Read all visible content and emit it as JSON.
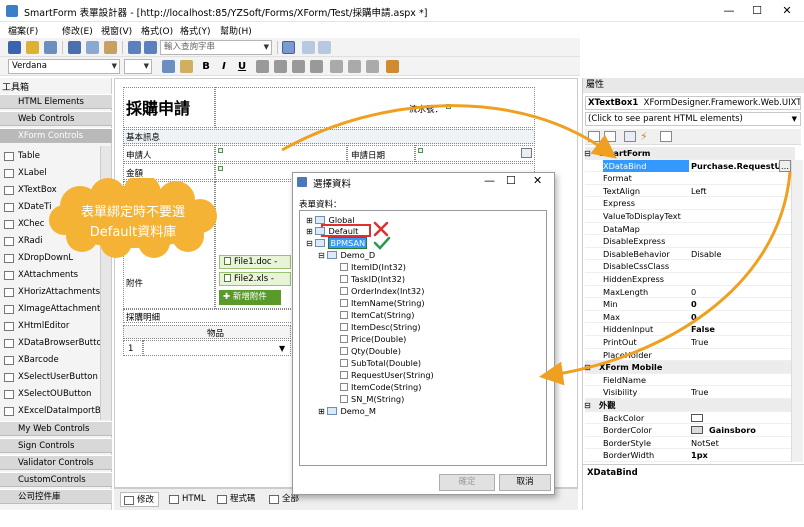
{
  "window": {
    "title": "SmartForm 表單設計器 - [http://localhost:85/YZSoft/Forms/XForm/Test/採購申請.aspx *]"
  },
  "menu": [
    "檔案(F)",
    "修改(E)",
    "視窗(V)",
    "格式(O)",
    "格式(Y)",
    "幫助(H)"
  ],
  "toolbar": {
    "input_placeholder": "輸入查詢字串",
    "font": "Verdana"
  },
  "toolbox": {
    "title": "工具箱",
    "groups_top": [
      "HTML Elements",
      "Web Controls",
      "XForm Controls"
    ],
    "items": [
      "Table",
      "XLabel",
      "XTextBox",
      "XDateTi",
      "XChec",
      "XRadi",
      "XDropDownL",
      "XAttachments",
      "XHorizAttachments",
      "XImageAttachment",
      "XHtmlEditor",
      "XDataBrowserButton",
      "XBarcode",
      "XSelectUserButton",
      "XSelectOUButton",
      "XExcelDataImportB..."
    ],
    "groups_bottom": [
      "My Web Controls",
      "Sign Controls",
      "Validator Controls",
      "CustomControls",
      "公司控件庫"
    ]
  },
  "form": {
    "title": "採購申請",
    "serial_label": "流水號：",
    "section_basic": "基本訊息",
    "applicant": "申請人",
    "apply_date": "申請日期",
    "amount": "金額",
    "attachments": "附件",
    "file1": "File1.doc -",
    "file2": "File2.xls -",
    "add_attachment": "新增附件",
    "section_detail": "採購明細",
    "item_col": "物品",
    "row_num": "1"
  },
  "bottom_tabs": [
    "修改",
    "HTML",
    "程式碼",
    "全部"
  ],
  "properties": {
    "title": "屬性",
    "object": "XTextBox1",
    "object_type": "XFormDesigner.Framework.Web.UIXTe",
    "parent_hint": "(Click to see parent HTML elements)",
    "rows": [
      {
        "name": "SmartForm",
        "value": "",
        "cat": true
      },
      {
        "name": "XDataBind",
        "value": "Purchase.RequestUse",
        "sel": true
      },
      {
        "name": "Format",
        "value": ""
      },
      {
        "name": "TextAlign",
        "value": "Left"
      },
      {
        "name": "Express",
        "value": ""
      },
      {
        "name": "ValueToDisplayText",
        "value": ""
      },
      {
        "name": "DataMap",
        "value": ""
      },
      {
        "name": "DisableExpress",
        "value": ""
      },
      {
        "name": "DisableBehavior",
        "value": "Disable"
      },
      {
        "name": "DisableCssClass",
        "value": ""
      },
      {
        "name": "HiddenExpress",
        "value": ""
      },
      {
        "name": "MaxLength",
        "value": "0"
      },
      {
        "name": "Min",
        "value": "0"
      },
      {
        "name": "Max",
        "value": "0"
      },
      {
        "name": "HiddenInput",
        "value": "False"
      },
      {
        "name": "PrintOut",
        "value": "True"
      },
      {
        "name": "PlaceHolder",
        "value": ""
      },
      {
        "name": "XForm Mobile",
        "value": "",
        "cat": true
      },
      {
        "name": "FieldName",
        "value": ""
      },
      {
        "name": "Visibility",
        "value": "True"
      },
      {
        "name": "外觀",
        "value": "",
        "cat": true
      },
      {
        "name": "BackColor",
        "value": ""
      },
      {
        "name": "BorderColor",
        "value": "Gainsboro"
      },
      {
        "name": "BorderStyle",
        "value": "NotSet"
      },
      {
        "name": "BorderWidth",
        "value": "1px"
      }
    ],
    "footer": "XDataBind"
  },
  "dialog": {
    "title": "選擇資料",
    "label": "表單資料：",
    "tree": {
      "global": "Global",
      "default": "Default",
      "bpmsan": "BPMSAN",
      "demo_d": "Demo_D",
      "fields": [
        "ItemID(Int32)",
        "TaskID(Int32)",
        "OrderIndex(Int32)",
        "ItemName(String)",
        "ItemCat(String)",
        "ItemDesc(String)",
        "Price(Double)",
        "Qty(Double)",
        "SubTotal(Double)",
        "RequestUser(String)",
        "ItemCode(String)",
        "SN_M(String)"
      ],
      "demo_m": "Demo_M"
    },
    "ok": "確定",
    "cancel": "取消"
  },
  "callout": {
    "line1": "表單綁定時不要選",
    "line2": "Default資料庫"
  },
  "colors": {
    "arrow": "#f0a020",
    "cloud": "#f5b335",
    "cross": "#e03030",
    "check": "#2a9a4a"
  }
}
